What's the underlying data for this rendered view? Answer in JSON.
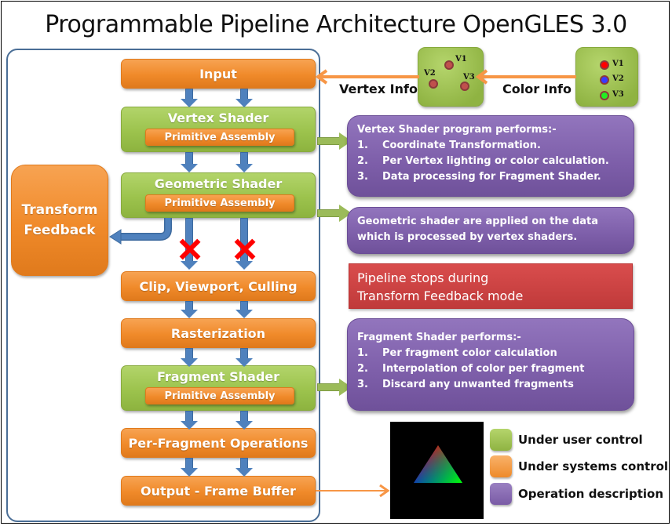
{
  "title": "Programmable Pipeline Architecture OpenGLES 3.0",
  "pipeline": {
    "input": "Input",
    "vertex_shader": {
      "label": "Vertex Shader",
      "sub": "Primitive Assembly"
    },
    "geometric_shader": {
      "label": "Geometric Shader",
      "sub": "Primitive Assembly"
    },
    "clip": "Clip, Viewport, Culling",
    "rasterization": "Rasterization",
    "fragment_shader": {
      "label": "Fragment Shader",
      "sub": "Primitive Assembly"
    },
    "per_fragment": "Per-Fragment Operations",
    "output": "Output - Frame Buffer"
  },
  "transform_feedback": {
    "line1": "Transform",
    "line2": "Feedback"
  },
  "vertex_info": {
    "label": "Vertex Info",
    "vertices": [
      "V1",
      "V2",
      "V3"
    ]
  },
  "color_info": {
    "label": "Color Info",
    "vertices": [
      {
        "name": "V1",
        "color": "#ff0000"
      },
      {
        "name": "V2",
        "color": "#3a3aff"
      },
      {
        "name": "V3",
        "color": "#22ee22"
      }
    ]
  },
  "descriptions": {
    "vertex": {
      "heading": "Vertex Shader program performs:-",
      "items": [
        {
          "n": "1.",
          "text": "Coordinate Transformation."
        },
        {
          "n": "2.",
          "text": "Per Vertex lighting or color calculation."
        },
        {
          "n": "3.",
          "text": "Data processing for Fragment Shader."
        }
      ]
    },
    "geometric": {
      "line1": "Geometric shader  are applied on the data",
      "line2": "which is processed by vertex shaders."
    },
    "fragment": {
      "heading": "Fragment Shader performs:-",
      "items": [
        {
          "n": "1.",
          "text": "Per fragment color calculation"
        },
        {
          "n": "2.",
          "text": "Interpolation of color per fragment"
        },
        {
          "n": "3.",
          "text": "Discard any unwanted fragments"
        }
      ]
    }
  },
  "stop_note": {
    "line1": "Pipeline stops during",
    "line2": "Transform Feedback mode"
  },
  "legend": [
    {
      "label": "Under user control",
      "color": "#9bbb59"
    },
    {
      "label": "Under systems control",
      "color": "#f79646"
    },
    {
      "label": "Operation description",
      "color": "#8064a2"
    }
  ],
  "colors": {
    "user_control": "#9bbb59",
    "system_control": "#f79646",
    "description": "#8064a2",
    "flow_arrow": "#4f81bd",
    "stop_mark": "#ff0000",
    "stop_note": "#c0504d"
  }
}
